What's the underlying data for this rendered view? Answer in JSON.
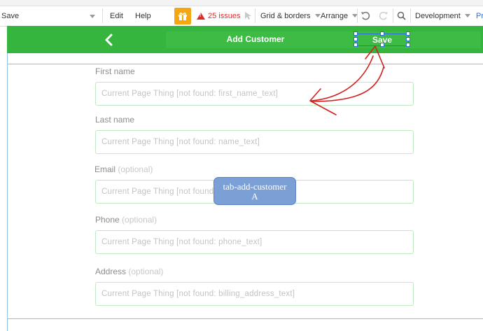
{
  "toolbar": {
    "page_select": "Save",
    "edit": "Edit",
    "help": "Help",
    "issues": "25 issues",
    "grid_borders": "Grid & borders",
    "arrange": "Arrange",
    "environment": "Development",
    "preview_cut": "Pr"
  },
  "appbar": {
    "title": "Add Customer",
    "save_label": "Save"
  },
  "form": {
    "first_name_label": "First name",
    "first_name_value": "Current Page Thing [not found: first_name_text]",
    "last_name_label": "Last name",
    "last_name_value": "Current Page Thing [not found: name_text]",
    "email_label": "Email",
    "email_optional": "(optional)",
    "email_value": "Current Page Thing [not found: email_text]",
    "phone_label": "Phone",
    "phone_optional": "(optional)",
    "phone_value": "Current Page Thing [not found: phone_text]",
    "address_label": "Address",
    "address_optional": "(optional)",
    "address_value": "Current Page Thing [not found: billing_address_text]"
  },
  "tooltip": {
    "line1": "tab-add-customer",
    "line2": "A"
  },
  "colors": {
    "header_green": "#35b53e",
    "issues_red": "#e02b2b",
    "gift_orange": "#f3a712",
    "selection_blue": "#2a6fd6",
    "tooltip_blue": "#7ba0d6",
    "annotation_red": "#d0201f"
  }
}
